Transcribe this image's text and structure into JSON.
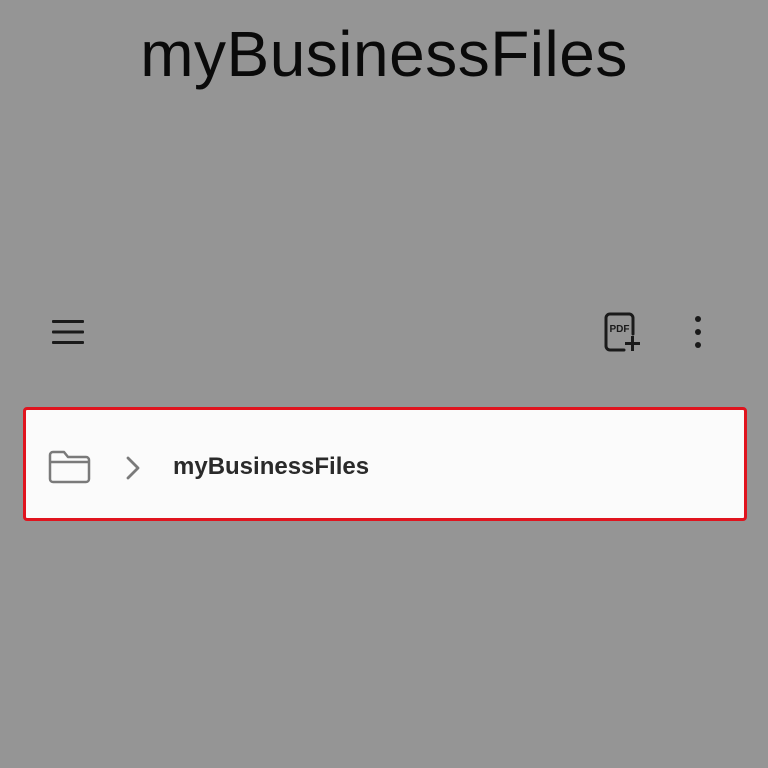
{
  "caption": {
    "title": "myBusinessFiles"
  },
  "toolbar": {
    "menu_icon": "hamburger-menu-icon",
    "pdf_icon": "pdf-add-icon",
    "pdf_icon_text": "PDF",
    "more_icon": "more-vertical-icon"
  },
  "breadcrumb": {
    "root_icon": "folder-icon",
    "separator_icon": "chevron-right-icon",
    "items": [
      {
        "label": "myBusinessFiles"
      }
    ],
    "highlight_color": "#e0141e"
  },
  "colors": {
    "background": "#959595",
    "card": "#fbfbfb",
    "text": "#2a2a2a"
  }
}
